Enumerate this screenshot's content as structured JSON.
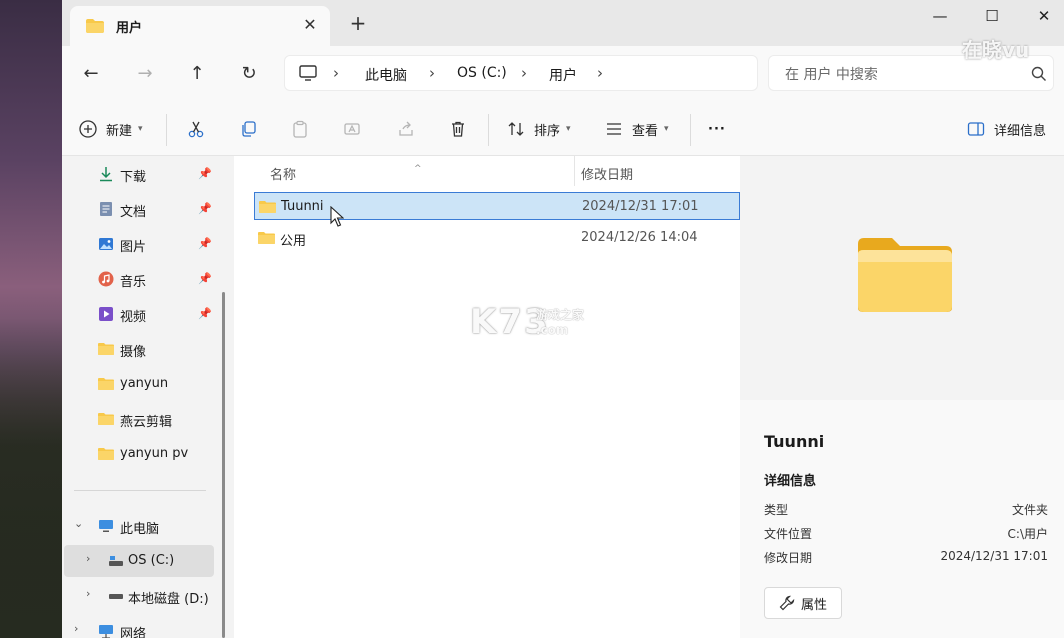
{
  "window": {
    "tab_title": "用户",
    "minimize": "—",
    "maximize": "☐",
    "close": "✕"
  },
  "address": {
    "crumbs": [
      "此电脑",
      "OS (C:)",
      "用户"
    ],
    "search_placeholder": "在 用户 中搜索"
  },
  "toolbar": {
    "new_label": "新建",
    "sort_label": "排序",
    "view_label": "查看",
    "more_label": "···",
    "details_label": "详细信息"
  },
  "sidebar": {
    "quick_access": [
      {
        "label": "下载",
        "icon": "download-icon",
        "pinned": true
      },
      {
        "label": "文档",
        "icon": "document-icon",
        "pinned": true
      },
      {
        "label": "图片",
        "icon": "pictures-icon",
        "pinned": true
      },
      {
        "label": "音乐",
        "icon": "music-icon",
        "pinned": true
      },
      {
        "label": "视频",
        "icon": "video-icon",
        "pinned": true
      },
      {
        "label": "摄像",
        "icon": "folder-icon",
        "pinned": false
      },
      {
        "label": "yanyun",
        "icon": "folder-icon",
        "pinned": false
      },
      {
        "label": "燕云剪辑",
        "icon": "folder-icon",
        "pinned": false
      },
      {
        "label": "yanyun pv",
        "icon": "folder-icon",
        "pinned": false
      }
    ],
    "this_pc": "此电脑",
    "drives": [
      {
        "label": "OS (C:)",
        "selected": true
      },
      {
        "label": "本地磁盘 (D:)",
        "selected": false
      }
    ],
    "network": "网络"
  },
  "file_list": {
    "columns": [
      "名称",
      "修改日期"
    ],
    "rows": [
      {
        "name": "Tuunni",
        "date": "2024/12/31 17:01",
        "selected": true
      },
      {
        "name": "公用",
        "date": "2024/12/26 14:04",
        "selected": false
      }
    ]
  },
  "watermark": {
    "logo": "K73",
    "sub": "游戏之家",
    "domain": ".com",
    "corner": "在晓vu"
  },
  "details": {
    "name": "Tuunni",
    "section": "详细信息",
    "props": [
      {
        "key": "类型",
        "value": "文件夹"
      },
      {
        "key": "文件位置",
        "value": "C:\\用户"
      },
      {
        "key": "修改日期",
        "value": "2024/12/31 17:01"
      }
    ],
    "properties_button": "属性"
  },
  "colors": {
    "folder": "#f8c94a",
    "folder_dark": "#e8a91e",
    "selection_bg": "#cce4f7",
    "selection_border": "#3a7bd5"
  }
}
